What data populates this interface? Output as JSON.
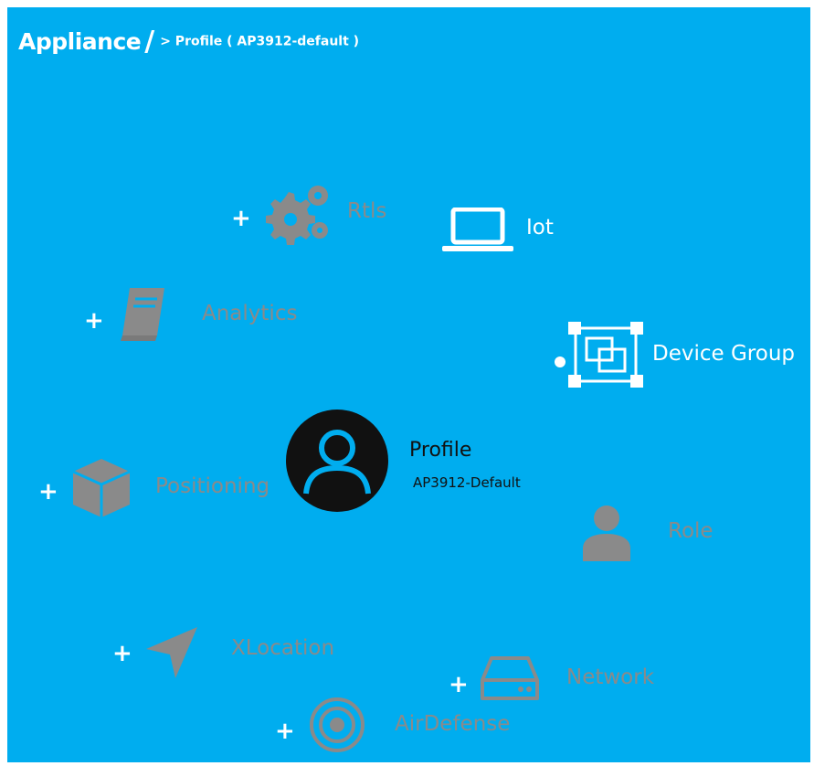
{
  "breadcrumb": {
    "root": "Appliance",
    "separator": "/",
    "current": "> Profile ( AP3912-default )"
  },
  "center": {
    "title": "Profile",
    "subtitle": "AP3912-Default",
    "icon": "user-circle-icon"
  },
  "nodes": {
    "rtls": {
      "label": "Rtls",
      "icon": "gears-icon",
      "expand": "+",
      "active": false
    },
    "iot": {
      "label": "Iot",
      "icon": "laptop-icon",
      "active": true
    },
    "analytics": {
      "label": "Analytics",
      "icon": "book-icon",
      "expand": "+",
      "active": false
    },
    "device_group": {
      "label": "Device Group",
      "icon": "device-group-icon",
      "active": true
    },
    "positioning": {
      "label": "Positioning",
      "icon": "cube-icon",
      "expand": "+",
      "active": false
    },
    "role": {
      "label": "Role",
      "icon": "person-icon",
      "active": false
    },
    "xlocation": {
      "label": "XLocation",
      "icon": "navigation-arrow-icon",
      "expand": "+",
      "active": false
    },
    "network": {
      "label": "Network",
      "icon": "hard-drive-icon",
      "expand": "+",
      "active": false
    },
    "airdefense": {
      "label": "AirDefense",
      "icon": "target-icon",
      "expand": "+",
      "active": false
    }
  },
  "colors": {
    "background": "#00adef",
    "inactive": "#8a8a8a",
    "active": "#ffffff",
    "center": "#111111"
  }
}
